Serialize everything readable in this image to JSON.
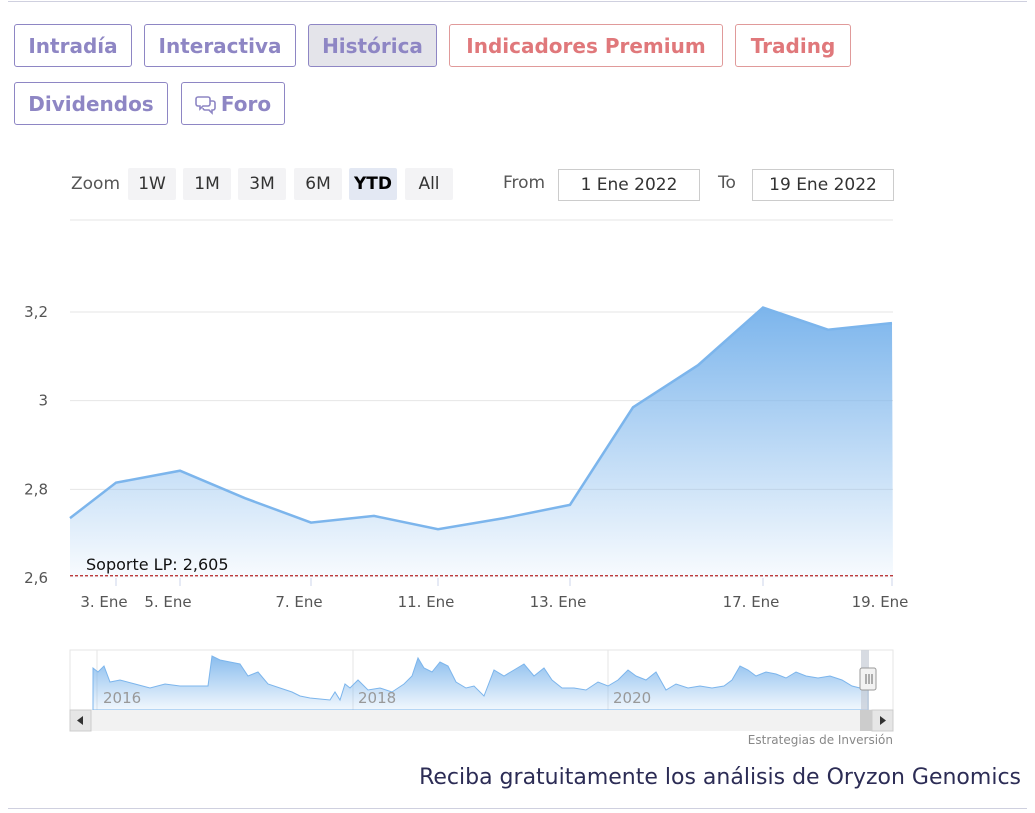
{
  "tabs": [
    {
      "label": "Intradía",
      "state": "normal"
    },
    {
      "label": "Interactiva",
      "state": "normal"
    },
    {
      "label": "Histórica",
      "state": "active"
    },
    {
      "label": "Indicadores Premium",
      "state": "premium"
    },
    {
      "label": "Trading",
      "state": "premium"
    },
    {
      "label": "Dividendos",
      "state": "normal"
    },
    {
      "label": "Foro",
      "state": "normal",
      "icon": "chat-bubbles-icon"
    }
  ],
  "range_selector": {
    "zoom_label": "Zoom",
    "buttons": [
      "1W",
      "1M",
      "3M",
      "6M",
      "YTD",
      "All"
    ],
    "selected": "YTD",
    "from_label": "From",
    "from_value": "1 Ene 2022",
    "to_label": "To",
    "to_value": "19 Ene 2022"
  },
  "chart_data": {
    "type": "area",
    "x_ticks": [
      "3. Ene",
      "5. Ene",
      "7. Ene",
      "11. Ene",
      "13. Ene",
      "17. Ene",
      "19. Ene"
    ],
    "y_ticks": [
      "3,2",
      "3",
      "2,8",
      "2,6"
    ],
    "ylim": [
      2.6,
      3.3
    ],
    "series": [
      {
        "values": [
          {
            "x": "2022-01-03",
            "y": 2.815
          },
          {
            "x": "2022-01-05",
            "y": 2.842
          },
          {
            "x": "2022-01-06",
            "y": 2.78
          },
          {
            "x": "2022-01-07",
            "y": 2.725
          },
          {
            "x": "2022-01-10",
            "y": 2.74
          },
          {
            "x": "2022-01-11",
            "y": 2.71
          },
          {
            "x": "2022-01-12",
            "y": 2.735
          },
          {
            "x": "2022-01-13",
            "y": 2.765
          },
          {
            "x": "2022-01-14",
            "y": 2.985
          },
          {
            "x": "2022-01-16",
            "y": 3.08
          },
          {
            "x": "2022-01-17",
            "y": 3.21
          },
          {
            "x": "2022-01-18",
            "y": 3.16
          },
          {
            "x": "2022-01-19",
            "y": 3.175
          }
        ]
      }
    ],
    "support_line": {
      "label": "Soporte LP: 2,605",
      "value": 2.605,
      "color": "#b22222"
    },
    "line_color": "#7cb5ec",
    "navigator": {
      "year_labels": [
        "2016",
        "2018",
        "2020"
      ]
    }
  },
  "credit": "Estrategias de Inversión",
  "cta": "Reciba gratuitamente los análisis de Oryzon Genomics"
}
